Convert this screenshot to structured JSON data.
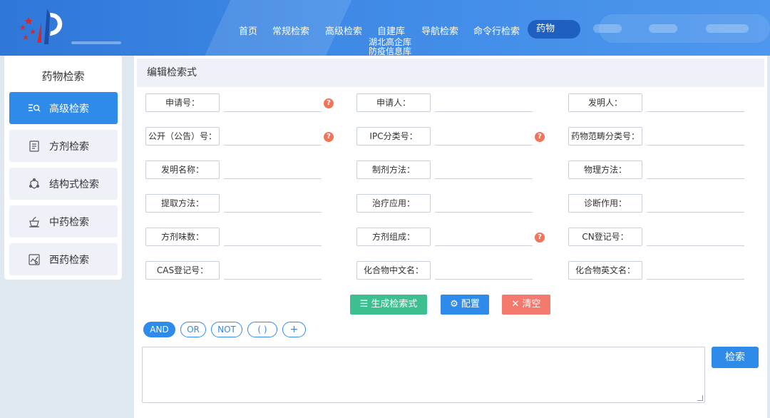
{
  "nav": {
    "items": [
      "首页",
      "常规检索",
      "高级检索",
      "自建库",
      "导航检索",
      "命令行检索",
      "药物"
    ],
    "subitems": [
      "湖北高企库",
      "防疫信息库"
    ]
  },
  "sidebar": {
    "title": "药物检索",
    "items": [
      {
        "label": "高级检索",
        "icon": "search-list-icon"
      },
      {
        "label": "方剂检索",
        "icon": "document-icon"
      },
      {
        "label": "结构式检索",
        "icon": "molecule-icon"
      },
      {
        "label": "中药检索",
        "icon": "herb-pot-icon"
      },
      {
        "label": "西药检索",
        "icon": "pill-chart-icon"
      }
    ]
  },
  "main": {
    "title": "编辑检索式",
    "fields": [
      {
        "label": "申请号：",
        "help": "?"
      },
      {
        "label": "申请人："
      },
      {
        "label": "发明人："
      },
      {
        "label": "公开（公告）号：",
        "help": "?"
      },
      {
        "label": "IPC分类号：",
        "help": "?"
      },
      {
        "label": "药物范畴分类号："
      },
      {
        "label": "发明名称："
      },
      {
        "label": "制剂方法："
      },
      {
        "label": "物理方法："
      },
      {
        "label": "提取方法："
      },
      {
        "label": "治疗应用："
      },
      {
        "label": "诊断作用："
      },
      {
        "label": "方剂味数："
      },
      {
        "label": "方剂组成：",
        "help": "?"
      },
      {
        "label": "CN登记号："
      },
      {
        "label": "CAS登记号："
      },
      {
        "label": "化合物中文名："
      },
      {
        "label": "化合物英文名："
      }
    ],
    "buttons": {
      "generate": "生成检索式",
      "config": "配置",
      "clear": "清空"
    },
    "operators": [
      "AND",
      "OR",
      "NOT",
      "( )",
      "+"
    ],
    "search": "检索"
  },
  "colors": {
    "header": "#3f8ae6",
    "accent": "#2f8bea",
    "green": "#3ebf8f",
    "red": "#f47a6e"
  }
}
